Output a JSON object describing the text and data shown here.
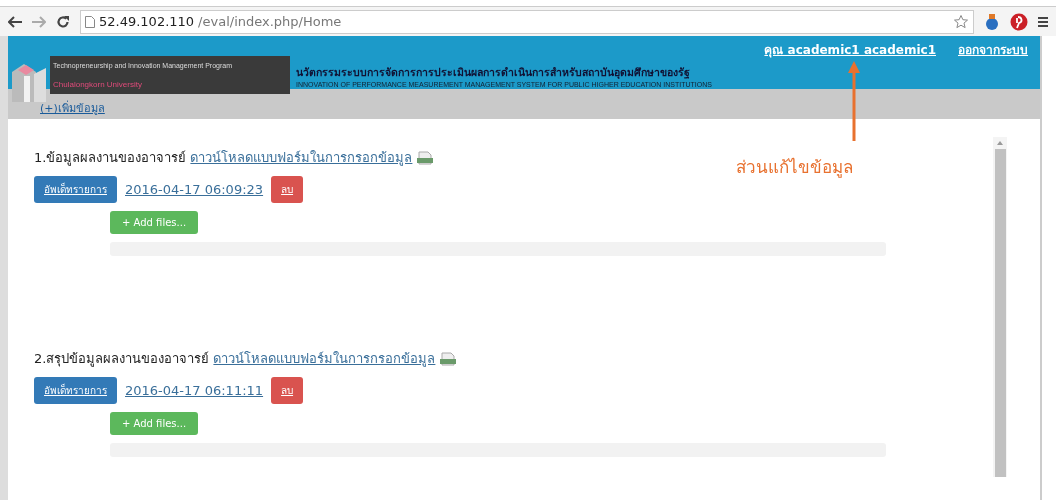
{
  "browser": {
    "url_host": "52.49.102.110",
    "url_path": "/eval/index.php/Home"
  },
  "header": {
    "user_link": "คุณ academic1 academic1",
    "logout_link": "ออกจากระบบ",
    "logo_line_1": "Technopreneurship and Innovation Management Program",
    "logo_line_2": "Chulalongkorn University",
    "title_th": "นวัตกรรมระบบการจัดการการประเมินผลการดำเนินการสำหรับสถาบันอุดมศึกษาของรัฐ",
    "title_en": "INNOVATION OF PERFORMANCE MEASUREMENT MANAGEMENT SYSTEM FOR PUBLIC HIGHER EDUCATION INSTITUTIONS"
  },
  "add_link": "(+)เพิ่มข้อมูล",
  "annotation": "ส่วนแก้ไขข้อมูล",
  "sections": [
    {
      "title": "1.ข้อมูลผลงานของอาจารย์",
      "download_link": "ดาวน์โหลดแบบฟอร์มในการกรอกข้อมูล",
      "update_button": "อัพเด็ทรายการ",
      "file_link": "2016-04-17 06:09:23",
      "delete_button": "ลบ",
      "add_files_button": "+ Add files...",
      "level": 0
    },
    {
      "title": "2.สรุปข้อมูลผลงานของอาจารย์",
      "download_link": "ดาวน์โหลดแบบฟอร์มในการกรอกข้อมูล",
      "update_button": "อัพเด็ทรายการ",
      "file_link": "2016-04-17 06:11:11",
      "delete_button": "ลบ",
      "add_files_button": "+ Add files...",
      "level": 0
    }
  ]
}
